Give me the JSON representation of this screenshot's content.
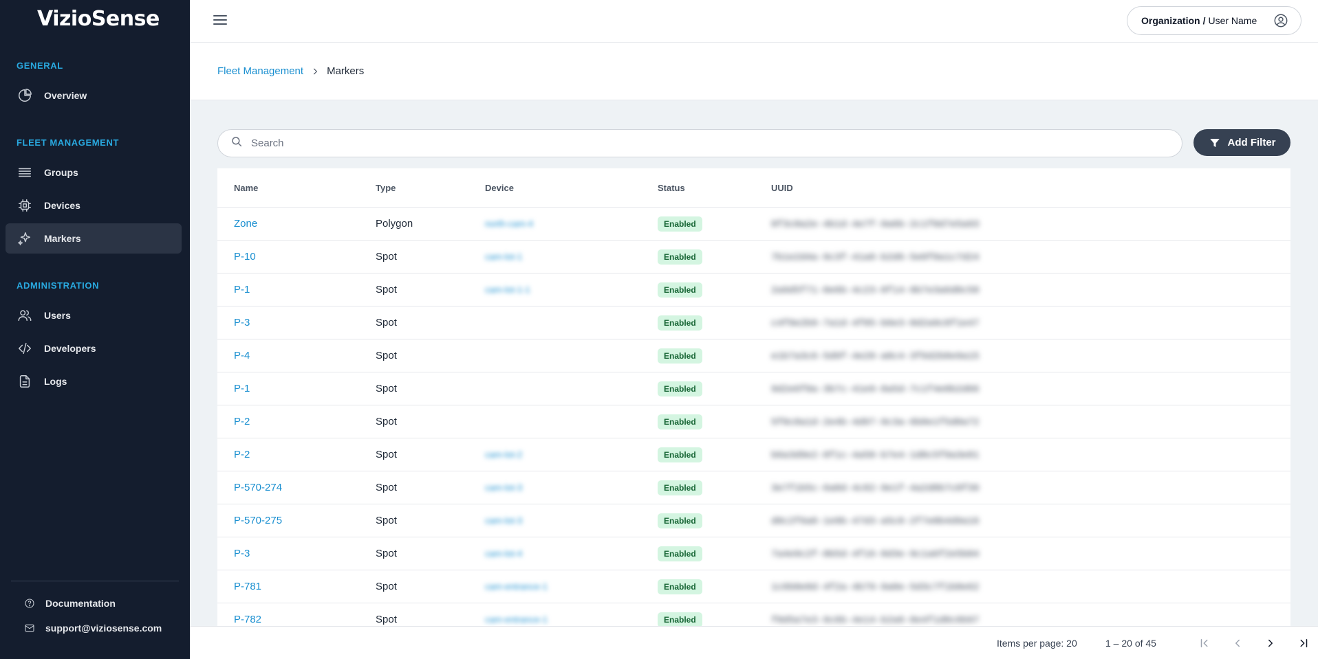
{
  "brand": {
    "logo_text": "VizioSense"
  },
  "sidebar": {
    "sections": {
      "general": "GENERAL",
      "fleet": "FLEET MANAGEMENT",
      "admin": "ADMINISTRATION"
    },
    "items": {
      "overview": "Overview",
      "groups": "Groups",
      "devices": "Devices",
      "markers": "Markers",
      "users": "Users",
      "developers": "Developers",
      "logs": "Logs"
    },
    "active_item": "markers",
    "footer": {
      "documentation": "Documentation",
      "support_email": "support@viziosense.com"
    }
  },
  "topbar": {
    "organization": "Organization",
    "separator": "/",
    "user_name": "User Name"
  },
  "breadcrumb": {
    "parent": "Fleet Management",
    "current": "Markers"
  },
  "search": {
    "placeholder": "Search",
    "value": ""
  },
  "toolbar": {
    "add_filter_label": "Add Filter"
  },
  "table": {
    "headers": {
      "name": "Name",
      "type": "Type",
      "device": "Device",
      "status": "Status",
      "uuid": "UUID"
    },
    "rows": [
      {
        "name": "Zone",
        "type": "Polygon",
        "device": "north-cam-4",
        "status": "Enabled",
        "uuid": "8f3c0a2e-4b1d-4e7f-9a6b-2c1f0d7e5a93"
      },
      {
        "name": "P-10",
        "type": "Spot",
        "device": "cam-lot-1",
        "status": "Enabled",
        "uuid": "7b1e2d4a-9c3f-41a8-b2d6-5e0f8a1c7d24"
      },
      {
        "name": "P-1",
        "type": "Spot",
        "device": "cam-lot-1-1",
        "status": "Enabled",
        "uuid": "2a9d5f71-0e6b-4c23-8f14-9b7e3a6d0c58"
      },
      {
        "name": "P-3",
        "type": "Spot",
        "device": "",
        "status": "Enabled",
        "uuid": "c4f8e2b9-7a1d-4f05-b6e3-0d2a9c8f1e47"
      },
      {
        "name": "P-4",
        "type": "Spot",
        "device": "",
        "status": "Enabled",
        "uuid": "e1b7a3c6-5d9f-4e28-a0c4-3f6d2b8e9a15"
      },
      {
        "name": "P-1",
        "type": "Spot",
        "device": "",
        "status": "Enabled",
        "uuid": "9d2e6f0a-3b7c-41e9-8a5d-7c1f4e0b2d66"
      },
      {
        "name": "P-2",
        "type": "Spot",
        "device": "",
        "status": "Enabled",
        "uuid": "5f0c8a1d-2e4b-4d97-9c3a-6b8e1f5d0a72"
      },
      {
        "name": "P-2",
        "type": "Spot",
        "device": "cam-lot-2",
        "status": "Enabled",
        "uuid": "b6a3d9e2-8f1c-4a50-b7e4-1d0c5f9a3e81"
      },
      {
        "name": "P-570-274",
        "type": "Spot",
        "device": "cam-lot-3",
        "status": "Enabled",
        "uuid": "3e7f1b5c-6a0d-4c82-9e1f-4a2d8b7c0f39"
      },
      {
        "name": "P-570-275",
        "type": "Spot",
        "device": "cam-lot-3",
        "status": "Enabled",
        "uuid": "d8c2f6a0-1e9b-47d3-a5c8-2f7e0b4d9a16"
      },
      {
        "name": "P-3",
        "type": "Spot",
        "device": "cam-lot-4",
        "status": "Enabled",
        "uuid": "7a4e9c2f-0b5d-4f16-8d3e-9c1a6f2e5b04"
      },
      {
        "name": "P-781",
        "type": "Spot",
        "device": "cam-entrance-1",
        "status": "Enabled",
        "uuid": "1c6b0e8d-4f2a-4b79-9a0e-5d3c7f1b8e62"
      },
      {
        "name": "P-782",
        "type": "Spot",
        "device": "cam-entrance-1",
        "status": "Enabled",
        "uuid": "f0d5a7e3-9c6b-4e14-b2a8-8e4f1d0c6b97"
      }
    ]
  },
  "paginator": {
    "items_per_page_label": "Items per page: 20",
    "range_label": "1 – 20 of 45"
  },
  "colors": {
    "sidebar_bg": "#141d2e",
    "accent": "#29a9e0",
    "link": "#1a8fd0",
    "badge_bg": "#d4f5e1",
    "badge_text": "#166534",
    "button_bg": "#364152"
  }
}
